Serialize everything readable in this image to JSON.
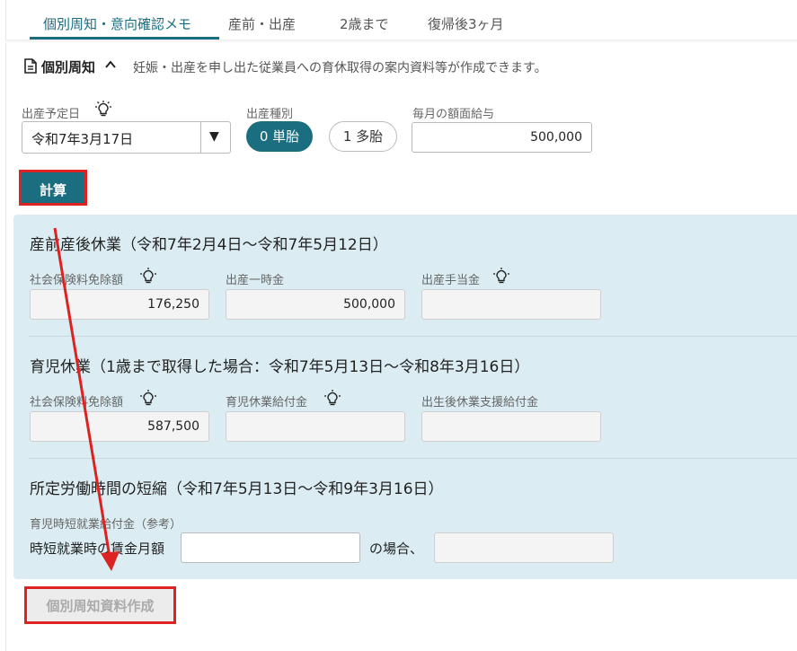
{
  "tabs": [
    "個別周知・意向確認メモ",
    "産前・出産",
    "2歳まで",
    "復帰後3ヶ月"
  ],
  "section": {
    "title": "個別周知",
    "description": "妊娠・出産を申し出た従業員への育休取得の案内資料等が作成できます。"
  },
  "form": {
    "due_date_label": "出産予定日",
    "due_date_value": "令和7年3月17日",
    "birth_type_label": "出産種別",
    "birth_single": "0 単胎",
    "birth_multiple": "1 多胎",
    "salary_label": "毎月の額面給与",
    "salary_value": "500,000",
    "calc_button": "計算"
  },
  "maternity": {
    "title": "産前産後休業（令和7年2月4日～令和7年5月12日）",
    "insurance_label": "社会保険料免除額",
    "insurance_value": "176,250",
    "lump_sum_label": "出産一時金",
    "lump_sum_value": "500,000",
    "allowance_label": "出産手当金",
    "allowance_value": ""
  },
  "childcare": {
    "title": "育児休業（1歳まで取得した場合：令和7年5月13日～令和8年3月16日）",
    "insurance_label": "社会保険料免除額",
    "insurance_value": "587,500",
    "benefit_label": "育児休業給付金",
    "benefit_value": "",
    "postnatal_label": "出生後休業支援給付金",
    "postnatal_value": ""
  },
  "shorttime": {
    "title": "所定労働時間の短縮（令和7年5月13日～令和9年3月16日）",
    "ref_label": "育児時短就業給付金（参考）",
    "wage_text": "時短就業時の賃金月額",
    "wage_value": "",
    "case_text": "の場合、",
    "result_value": ""
  },
  "generate_button": "個別周知資料作成",
  "colors": {
    "accent": "#1b6d80",
    "panel": "#dbedf3",
    "highlight": "#dd2222"
  }
}
